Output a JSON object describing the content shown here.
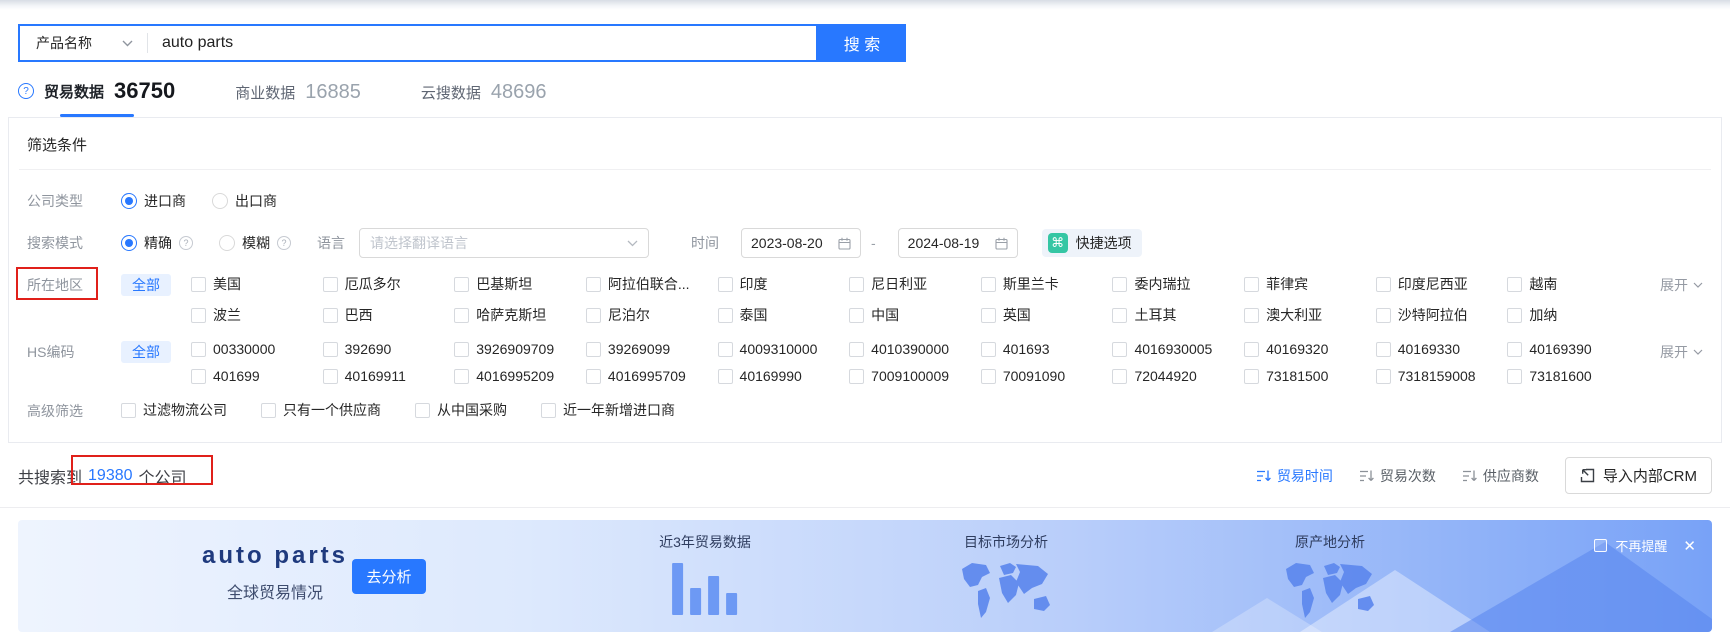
{
  "colors": {
    "primary": "#2878ff",
    "annotation_red": "#e0201a",
    "quick_icon_green": "#35c6a4"
  },
  "search": {
    "category": "产品名称",
    "query": "auto parts",
    "button": "搜 索"
  },
  "tabs": {
    "trade": {
      "label": "贸易数据",
      "count": "36750"
    },
    "business": {
      "label": "商业数据",
      "count": "16885"
    },
    "cloud": {
      "label": "云搜数据",
      "count": "48696"
    }
  },
  "filters": {
    "title": "筛选条件",
    "company_type": {
      "label": "公司类型",
      "importer": "进口商",
      "exporter": "出口商"
    },
    "search_mode": {
      "label": "搜索模式",
      "exact": "精确",
      "fuzzy": "模糊"
    },
    "language": {
      "label": "语言",
      "placeholder": "请选择翻译语言"
    },
    "time": {
      "label": "时间",
      "start": "2023-08-20",
      "separator": "-",
      "end": "2024-08-19"
    },
    "quick_options": {
      "label": "快捷选项"
    },
    "region": {
      "label": "所在地区",
      "all": "全部",
      "expand": "展开",
      "row1": [
        "美国",
        "厄瓜多尔",
        "巴基斯坦",
        "阿拉伯联合...",
        "印度",
        "尼日利亚",
        "斯里兰卡",
        "委内瑞拉",
        "菲律宾",
        "印度尼西亚",
        "越南"
      ],
      "row2": [
        "波兰",
        "巴西",
        "哈萨克斯坦",
        "尼泊尔",
        "泰国",
        "中国",
        "英国",
        "土耳其",
        "澳大利亚",
        "沙特阿拉伯",
        "加纳"
      ]
    },
    "hs_code": {
      "label": "HS编码",
      "all": "全部",
      "expand": "展开",
      "row1": [
        "00330000",
        "392690",
        "3926909709",
        "39269099",
        "4009310000",
        "4010390000",
        "401693",
        "4016930005",
        "40169320",
        "40169330",
        "40169390"
      ],
      "row2": [
        "401699",
        "40169911",
        "4016995209",
        "4016995709",
        "40169990",
        "7009100009",
        "70091090",
        "72044920",
        "73181500",
        "7318159008",
        "73181600"
      ]
    },
    "advanced": {
      "label": "高级筛选",
      "options": [
        "过滤物流公司",
        "只有一个供应商",
        "从中国采购",
        "近一年新增进口商"
      ]
    }
  },
  "results": {
    "prefix": "共搜索到",
    "count": "19380",
    "suffix": "个公司",
    "sort_trade_time": "贸易时间",
    "sort_trade_count": "贸易次数",
    "sort_supplier_count": "供应商数",
    "crm_button": "导入内部CRM"
  },
  "banner": {
    "title": "auto parts",
    "subtitle": "全球贸易情况",
    "analyze": "去分析",
    "chart_label": "近3年贸易数据",
    "market_label": "目标市场分析",
    "origin_label": "原产地分析",
    "dismiss": "不再提醒",
    "close": "✕"
  }
}
